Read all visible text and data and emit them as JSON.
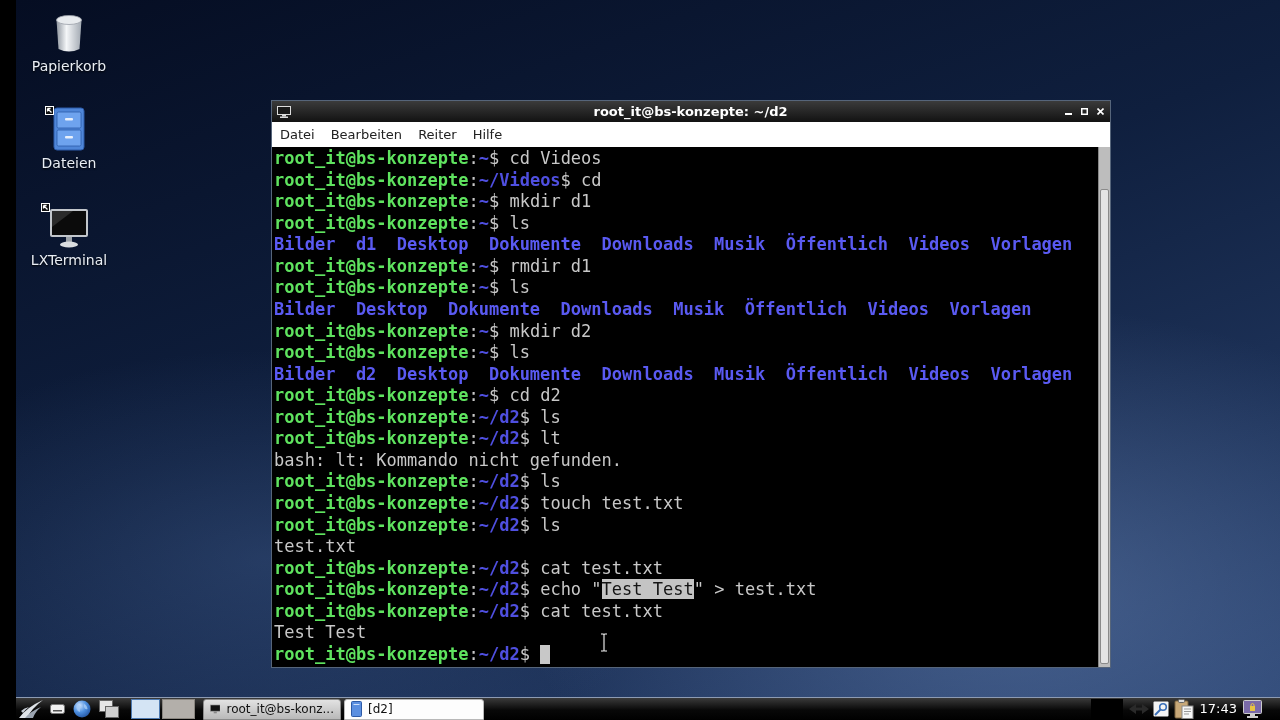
{
  "desktop_icons": [
    {
      "label": "Papierkorb",
      "kind": "trash",
      "shortcut": false
    },
    {
      "label": "Dateien",
      "kind": "cabinet",
      "shortcut": true
    },
    {
      "label": "LXTerminal",
      "kind": "monitor",
      "shortcut": true
    }
  ],
  "terminal_window": {
    "title": "root_it@bs-konzepte: ~/d2",
    "menu": [
      "Datei",
      "Bearbeiten",
      "Reiter",
      "Hilfe"
    ],
    "lines": [
      {
        "kind": "prompt",
        "user_host": "root_it@bs-konzepte",
        "separator": ":",
        "path": "~",
        "symbol": "$",
        "command": "cd Videos"
      },
      {
        "kind": "prompt",
        "user_host": "root_it@bs-konzepte",
        "separator": ":",
        "path": "~/Videos",
        "symbol": "$",
        "command": "cd"
      },
      {
        "kind": "prompt",
        "user_host": "root_it@bs-konzepte",
        "separator": ":",
        "path": "~",
        "symbol": "$",
        "command": "mkdir d1"
      },
      {
        "kind": "prompt",
        "user_host": "root_it@bs-konzepte",
        "separator": ":",
        "path": "~",
        "symbol": "$",
        "command": "ls"
      },
      {
        "kind": "listing",
        "items": [
          "Bilder",
          "d1",
          "Desktop",
          "Dokumente",
          "Downloads",
          "Musik",
          "Öffentlich",
          "Videos",
          "Vorlagen"
        ]
      },
      {
        "kind": "prompt",
        "user_host": "root_it@bs-konzepte",
        "separator": ":",
        "path": "~",
        "symbol": "$",
        "command": "rmdir d1"
      },
      {
        "kind": "prompt",
        "user_host": "root_it@bs-konzepte",
        "separator": ":",
        "path": "~",
        "symbol": "$",
        "command": "ls"
      },
      {
        "kind": "listing",
        "items": [
          "Bilder",
          "Desktop",
          "Dokumente",
          "Downloads",
          "Musik",
          "Öffentlich",
          "Videos",
          "Vorlagen"
        ]
      },
      {
        "kind": "prompt",
        "user_host": "root_it@bs-konzepte",
        "separator": ":",
        "path": "~",
        "symbol": "$",
        "command": "mkdir d2"
      },
      {
        "kind": "prompt",
        "user_host": "root_it@bs-konzepte",
        "separator": ":",
        "path": "~",
        "symbol": "$",
        "command": "ls"
      },
      {
        "kind": "listing",
        "items": [
          "Bilder",
          "d2",
          "Desktop",
          "Dokumente",
          "Downloads",
          "Musik",
          "Öffentlich",
          "Videos",
          "Vorlagen"
        ]
      },
      {
        "kind": "prompt",
        "user_host": "root_it@bs-konzepte",
        "separator": ":",
        "path": "~",
        "symbol": "$",
        "command": "cd d2"
      },
      {
        "kind": "prompt",
        "user_host": "root_it@bs-konzepte",
        "separator": ":",
        "path": "~/d2",
        "symbol": "$",
        "command": "ls"
      },
      {
        "kind": "prompt",
        "user_host": "root_it@bs-konzepte",
        "separator": ":",
        "path": "~/d2",
        "symbol": "$",
        "command": "lt"
      },
      {
        "kind": "output",
        "text": "bash: lt: Kommando nicht gefunden."
      },
      {
        "kind": "prompt",
        "user_host": "root_it@bs-konzepte",
        "separator": ":",
        "path": "~/d2",
        "symbol": "$",
        "command": "ls"
      },
      {
        "kind": "prompt",
        "user_host": "root_it@bs-konzepte",
        "separator": ":",
        "path": "~/d2",
        "symbol": "$",
        "command": "touch test.txt"
      },
      {
        "kind": "prompt",
        "user_host": "root_it@bs-konzepte",
        "separator": ":",
        "path": "~/d2",
        "symbol": "$",
        "command": "ls"
      },
      {
        "kind": "output",
        "text": "test.txt"
      },
      {
        "kind": "prompt",
        "user_host": "root_it@bs-konzepte",
        "separator": ":",
        "path": "~/d2",
        "symbol": "$",
        "command": "cat test.txt"
      },
      {
        "kind": "prompt",
        "user_host": "root_it@bs-konzepte",
        "separator": ":",
        "path": "~/d2",
        "symbol": "$",
        "command_parts": [
          {
            "text": "echo \"",
            "selected": false
          },
          {
            "text": "Test Test",
            "selected": true
          },
          {
            "text": "\" > test.txt",
            "selected": false
          }
        ]
      },
      {
        "kind": "prompt",
        "user_host": "root_it@bs-konzepte",
        "separator": ":",
        "path": "~/d2",
        "symbol": "$",
        "command": "cat test.txt"
      },
      {
        "kind": "output",
        "text": "Test Test"
      },
      {
        "kind": "input",
        "user_host": "root_it@bs-konzepte",
        "separator": ":",
        "path": "~/d2",
        "symbol": "$"
      }
    ]
  },
  "taskbar": {
    "workspaces": [
      {
        "selected": true
      },
      {
        "selected": false
      }
    ],
    "tasks": [
      {
        "title": "root_it@bs-konz...",
        "kind": "terminal",
        "selected": false
      },
      {
        "title": "[d2]",
        "kind": "document",
        "selected": true
      }
    ],
    "clock": "17:43"
  }
}
